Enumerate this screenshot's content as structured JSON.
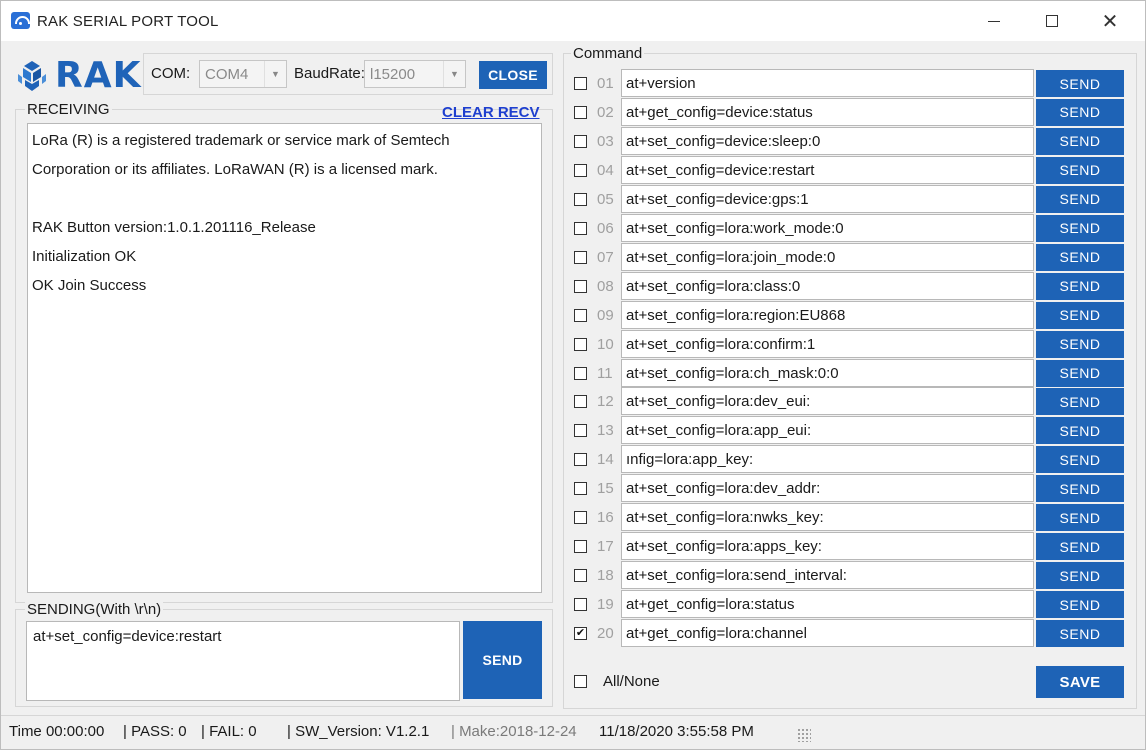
{
  "window": {
    "title": "RAK SERIAL PORT TOOL",
    "minimize_icon": "minimize-icon",
    "maximize_icon": "maximize-icon",
    "close_icon": "close-icon",
    "close_glyph": "✕"
  },
  "brand": {
    "logo_text": "RAK",
    "logo_color": "#1f63b8"
  },
  "connection": {
    "com_label": "COM:",
    "com_value": "COM4",
    "baud_label": "BaudRate:",
    "baud_value": "l15200",
    "close_label": "CLOSE"
  },
  "receiving": {
    "legend": "RECEIVING",
    "clear_label": "CLEAR RECV",
    "lines": [
      "LoRa (R) is a registered trademark or service mark of Semtech",
      "Corporation or its affiliates. LoRaWAN (R) is a licensed mark.",
      "",
      "RAK Button version:1.0.1.201116_Release",
      "Initialization OK",
      "OK Join Success"
    ]
  },
  "sending": {
    "legend": "SENDING(With \\r\\n)",
    "value": "at+set_config=device:restart",
    "send_label": "SEND"
  },
  "commands": {
    "legend": "Command",
    "send_label": "SEND",
    "items": [
      {
        "num": "01",
        "text": "at+version",
        "checked": false
      },
      {
        "num": "02",
        "text": "at+get_config=device:status",
        "checked": false
      },
      {
        "num": "03",
        "text": "at+set_config=device:sleep:0",
        "checked": false
      },
      {
        "num": "04",
        "text": "at+set_config=device:restart",
        "checked": false
      },
      {
        "num": "05",
        "text": "at+set_config=device:gps:1",
        "checked": false
      },
      {
        "num": "06",
        "text": "at+set_config=lora:work_mode:0",
        "checked": false
      },
      {
        "num": "07",
        "text": "at+set_config=lora:join_mode:0",
        "checked": false
      },
      {
        "num": "08",
        "text": "at+set_config=lora:class:0",
        "checked": false
      },
      {
        "num": "09",
        "text": "at+set_config=lora:region:EU868",
        "checked": false
      },
      {
        "num": "10",
        "text": "at+set_config=lora:confirm:1",
        "checked": false
      },
      {
        "num": "11",
        "text": "at+set_config=lora:ch_mask:0:0",
        "checked": false
      },
      {
        "num": "12",
        "text": "at+set_config=lora:dev_eui:",
        "checked": false
      },
      {
        "num": "13",
        "text": "at+set_config=lora:app_eui:",
        "checked": false
      },
      {
        "num": "14",
        "text": "ınfig=lora:app_key:",
        "checked": false
      },
      {
        "num": "15",
        "text": "at+set_config=lora:dev_addr:",
        "checked": false
      },
      {
        "num": "16",
        "text": "at+set_config=lora:nwks_key:",
        "checked": false
      },
      {
        "num": "17",
        "text": "at+set_config=lora:apps_key:",
        "checked": false
      },
      {
        "num": "18",
        "text": "at+set_config=lora:send_interval:",
        "checked": false
      },
      {
        "num": "19",
        "text": "at+get_config=lora:status",
        "checked": false
      },
      {
        "num": "20",
        "text": "at+get_config=lora:channel",
        "checked": true
      }
    ],
    "all_none_label": "All/None",
    "save_label": "SAVE"
  },
  "status": {
    "time": "Time  00:00:00",
    "pass": "| PASS:  0",
    "fail": "| FAIL:  0",
    "sw_version": "| SW_Version:  V1.2.1",
    "make": "| Make:2018-12-24",
    "datetime": "11/18/2020 3:55:58 PM"
  },
  "colors": {
    "accent": "#1e63b6",
    "link": "#1e3fcf",
    "window_bg": "#f0f0f0"
  }
}
